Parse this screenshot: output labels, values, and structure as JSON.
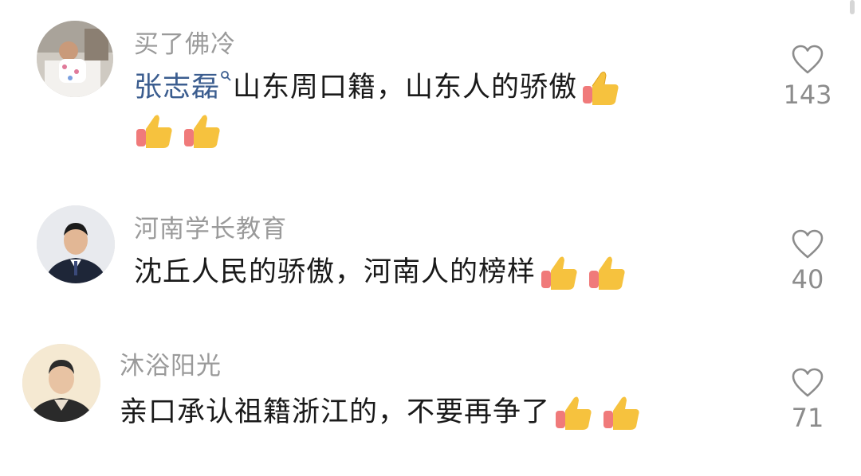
{
  "comments": [
    {
      "username": "买了佛冷",
      "mention": "张志磊",
      "text_line1": "山东周口籍，山东人的骄傲",
      "like_count": "143",
      "thumbs_line1": 1,
      "thumbs_line2": 2
    },
    {
      "username": "河南学长教育",
      "text_line1": "沈丘人民的骄傲，河南人的榜样",
      "like_count": "40",
      "thumbs_line1": 2
    },
    {
      "username": "沐浴阳光",
      "text_line1": "亲口承认祖籍浙江的，不要再争了",
      "like_count": "71",
      "thumbs_line1": 2
    }
  ],
  "icons": {
    "like": "heart-outline-icon",
    "thumbs": "thumbs-up-emoji",
    "mention": "search-magnifier-icon"
  },
  "colors": {
    "username": "#9a9a9a",
    "text": "#1a1a1a",
    "mention": "#3b5d8f",
    "like": "#8c8c8c",
    "thumb_skin": "#f6c23e",
    "thumb_cuff": "#f07a7a"
  }
}
